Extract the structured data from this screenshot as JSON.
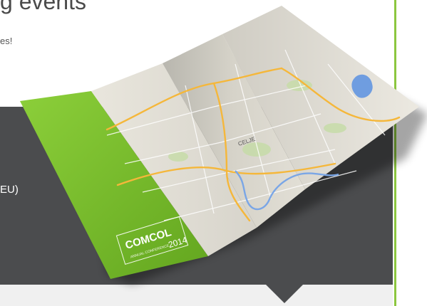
{
  "header": {
    "title": "g events",
    "tagline": "es!"
  },
  "panel": {
    "text": "EU)"
  },
  "brochure": {
    "brand": "COMCOL",
    "subtitle": "ANNUAL CONFERENCE",
    "year": "2014",
    "map_city_label": "CELJE",
    "accent": "#8cc63f",
    "panel_color": "#4b4c4e"
  }
}
